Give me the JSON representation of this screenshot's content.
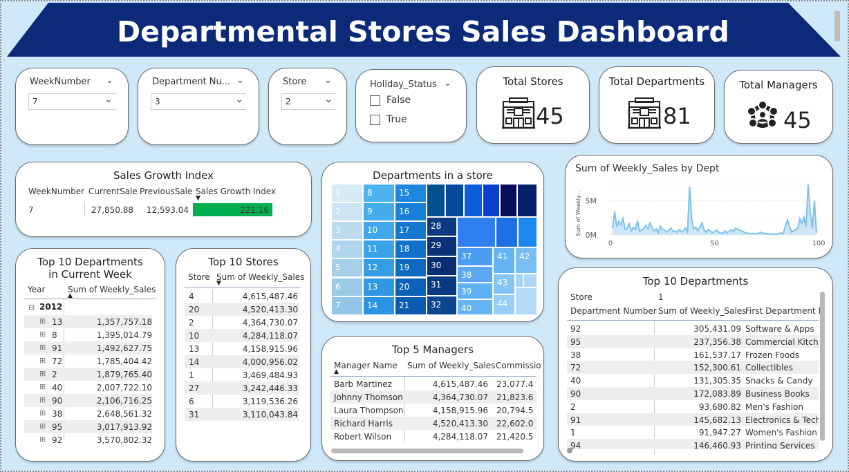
{
  "title": "Departmental Stores Sales Dashboard",
  "colors": {
    "banner": "#0c2a78",
    "canvas": "#cfe9f9",
    "growth_bar": "#00b050",
    "line": "#7fc0ee"
  },
  "slicers": {
    "week": {
      "title": "WeekNumber",
      "value": "7"
    },
    "dept": {
      "title": "Department Nu...",
      "value": "3"
    },
    "store": {
      "title": "Store",
      "value": "2"
    },
    "holiday": {
      "title": "Holiday_Status",
      "options": [
        "False",
        "True"
      ]
    }
  },
  "kpis": {
    "stores": {
      "title": "Total Stores",
      "value": "45",
      "icon": "store-icon"
    },
    "departments": {
      "title": "Total Departments",
      "value": "81",
      "icon": "store-icon"
    },
    "managers": {
      "title": "Total Managers",
      "value": "45",
      "icon": "managers-icon"
    }
  },
  "growth": {
    "title": "Sales Growth Index",
    "headers": [
      "WeekNumber",
      "CurrentSale",
      "PreviousSale",
      "Sales Growth Index"
    ],
    "row": {
      "week": "7",
      "current": "27,850.88",
      "previous": "12,593.04",
      "index": "221.16"
    }
  },
  "treemap": {
    "title": "Departments in a store",
    "labels": [
      "1",
      "2",
      "3",
      "4",
      "5",
      "6",
      "7",
      "8",
      "9",
      "10",
      "11",
      "12",
      "13",
      "14",
      "15",
      "16",
      "17",
      "18",
      "19",
      "20",
      "21",
      "28",
      "29",
      "30",
      "31",
      "32",
      "37",
      "38",
      "39",
      "40",
      "41",
      "42",
      "43",
      "44"
    ]
  },
  "line_chart": {
    "title": "Sum of Weekly_Sales by Dept",
    "ylabel": "Sum of Weekly...",
    "y_ticks": [
      "5M",
      "0M"
    ],
    "x_ticks": [
      "0",
      "50",
      "100"
    ]
  },
  "chart_data": {
    "type": "area",
    "title": "Sum of Weekly_Sales by Dept",
    "xlabel": "",
    "ylabel": "Sum of Weekly...",
    "xlim": [
      0,
      100
    ],
    "ylim": [
      0,
      8
    ],
    "y_unit": "M",
    "grid": true,
    "x": [
      1,
      2,
      3,
      4,
      5,
      6,
      7,
      8,
      9,
      10,
      11,
      12,
      13,
      14,
      16,
      17,
      18,
      19,
      20,
      21,
      22,
      23,
      24,
      25,
      26,
      27,
      28,
      29,
      30,
      31,
      32,
      33,
      34,
      35,
      36,
      37,
      38,
      39,
      40,
      41,
      42,
      44,
      45,
      46,
      47,
      48,
      49,
      50,
      51,
      52,
      54,
      55,
      56,
      58,
      59,
      60,
      65,
      67,
      71,
      72,
      74,
      79,
      80,
      81,
      82,
      83,
      85,
      87,
      90,
      91,
      92,
      93,
      94,
      95,
      96,
      97,
      98,
      99
    ],
    "series": [
      {
        "name": "",
        "values": [
          1.0,
          3.4,
          1.2,
          2.0,
          1.5,
          2.4,
          0.8,
          1.0,
          1.6,
          0.6,
          1.1,
          0.8,
          2.1,
          0.5,
          1.0,
          1.4,
          0.9,
          1.8,
          1.1,
          0.6,
          0.9,
          0.3,
          1.3,
          0.8,
          0.7,
          0.4,
          0.7,
          1.0,
          0.5,
          0.6,
          0.4,
          0.8,
          0.5,
          0.6,
          1.0,
          0.4,
          7.1,
          2.3,
          0.9,
          1.1,
          0.6,
          1.8,
          0.7,
          0.4,
          0.8,
          0.6,
          0.3,
          0.5,
          0.7,
          0.4,
          0.2,
          0.6,
          0.3,
          0.8,
          0.5,
          1.0,
          0.3,
          0.2,
          0.2,
          0.4,
          0.2,
          0.1,
          0.1,
          0.2,
          0.3,
          0.2,
          2.2,
          0.4,
          1.0,
          2.4,
          1.7,
          2.6,
          1.2,
          7.4,
          3.2,
          1.0,
          5.0,
          0.3
        ]
      }
    ]
  },
  "top10_week": {
    "title": "Top 10 Departments in Current Week",
    "headers": [
      "Year",
      "Sum of Weekly_Sales"
    ],
    "year": "2012",
    "rows": [
      {
        "dept": "13",
        "sales": "1,357,757.18"
      },
      {
        "dept": "8",
        "sales": "1,395,014.79"
      },
      {
        "dept": "91",
        "sales": "1,492,627.75"
      },
      {
        "dept": "72",
        "sales": "1,785,404.42"
      },
      {
        "dept": "2",
        "sales": "1,879,765.40"
      },
      {
        "dept": "40",
        "sales": "2,007,722.10"
      },
      {
        "dept": "90",
        "sales": "2,106,716.25"
      },
      {
        "dept": "38",
        "sales": "2,648,561.32"
      },
      {
        "dept": "95",
        "sales": "3,017,913.92"
      },
      {
        "dept": "92",
        "sales": "3,570,802.32"
      }
    ]
  },
  "top10_stores": {
    "title": "Top 10 Stores",
    "headers": [
      "Store",
      "Sum of Weekly_Sales"
    ],
    "rows": [
      {
        "store": "4",
        "sales": "4,615,487.46"
      },
      {
        "store": "20",
        "sales": "4,520,413.30"
      },
      {
        "store": "2",
        "sales": "4,364,730.07"
      },
      {
        "store": "10",
        "sales": "4,284,118.07"
      },
      {
        "store": "13",
        "sales": "4,158,915.96"
      },
      {
        "store": "14",
        "sales": "4,000,956.02"
      },
      {
        "store": "1",
        "sales": "3,469,484.93"
      },
      {
        "store": "27",
        "sales": "3,242,446.33"
      },
      {
        "store": "6",
        "sales": "3,119,536.26"
      },
      {
        "store": "31",
        "sales": "3,110,043.84"
      }
    ]
  },
  "top5_managers": {
    "title": "Top 5 Managers",
    "headers": [
      "Manager Name",
      "Sum of Weekly_Sales",
      "Commissio"
    ],
    "rows": [
      {
        "name": "Barb Martinez",
        "sales": "4,615,487.46",
        "comm": "23,077.4"
      },
      {
        "name": "Johnny Thomson",
        "sales": "4,364,730.07",
        "comm": "21,823.6"
      },
      {
        "name": "Laura Thompson",
        "sales": "4,158,915.96",
        "comm": "20,794.5"
      },
      {
        "name": "Richard Harris",
        "sales": "4,520,413.30",
        "comm": "22,602.0"
      },
      {
        "name": "Robert Wilson",
        "sales": "4,284,118.07",
        "comm": "21,420.5"
      }
    ]
  },
  "top10_depts": {
    "title": "Top 10 Departments",
    "store_label": "Store",
    "store_value": "1",
    "headers": [
      "Department Number",
      "Sum of Weekly_Sales",
      "First Department N"
    ],
    "rows": [
      {
        "dept": "92",
        "sales": "305,431.09",
        "name": "Software & Apps"
      },
      {
        "dept": "95",
        "sales": "237,356.38",
        "name": "Commercial Kitcher"
      },
      {
        "dept": "38",
        "sales": "161,537.17",
        "name": "Frozen Foods"
      },
      {
        "dept": "72",
        "sales": "152,300.61",
        "name": "Collectibles"
      },
      {
        "dept": "40",
        "sales": "131,305.35",
        "name": "Snacks & Candy"
      },
      {
        "dept": "90",
        "sales": "172,083.89",
        "name": "Business Books"
      },
      {
        "dept": "2",
        "sales": "93,680.82",
        "name": "Men's Fashion"
      },
      {
        "dept": "91",
        "sales": "145,682.13",
        "name": "Electronics & Tech"
      },
      {
        "dept": "1",
        "sales": "91,947.27",
        "name": "Women's Fashion"
      },
      {
        "dept": "94",
        "sales": "146,460.93",
        "name": "Printing Services"
      }
    ]
  }
}
